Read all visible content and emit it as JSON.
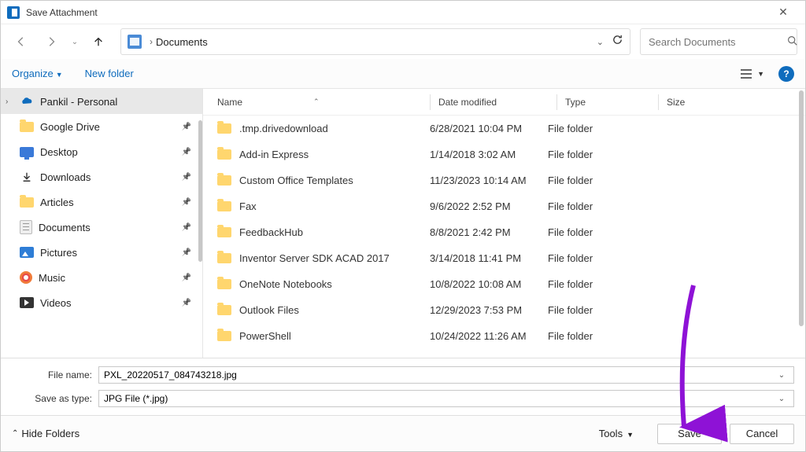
{
  "window": {
    "title": "Save Attachment"
  },
  "breadcrumb": {
    "location": "Documents"
  },
  "search": {
    "placeholder": "Search Documents"
  },
  "toolbar": {
    "organize": "Organize",
    "new_folder": "New folder"
  },
  "tree": {
    "root": "Pankil - Personal",
    "items": [
      {
        "label": "Google Drive",
        "icon": "folder"
      },
      {
        "label": "Desktop",
        "icon": "desktop"
      },
      {
        "label": "Downloads",
        "icon": "download"
      },
      {
        "label": "Articles",
        "icon": "folder"
      },
      {
        "label": "Documents",
        "icon": "doc"
      },
      {
        "label": "Pictures",
        "icon": "pic"
      },
      {
        "label": "Music",
        "icon": "music"
      },
      {
        "label": "Videos",
        "icon": "video"
      }
    ]
  },
  "columns": {
    "name": "Name",
    "date": "Date modified",
    "type": "Type",
    "size": "Size"
  },
  "rows": [
    {
      "name": ".tmp.drivedownload",
      "date": "6/28/2021 10:04 PM",
      "type": "File folder"
    },
    {
      "name": "Add-in Express",
      "date": "1/14/2018 3:02 AM",
      "type": "File folder"
    },
    {
      "name": "Custom Office Templates",
      "date": "11/23/2023 10:14 AM",
      "type": "File folder"
    },
    {
      "name": "Fax",
      "date": "9/6/2022 2:52 PM",
      "type": "File folder"
    },
    {
      "name": "FeedbackHub",
      "date": "8/8/2021 2:42 PM",
      "type": "File folder"
    },
    {
      "name": "Inventor Server SDK ACAD 2017",
      "date": "3/14/2018 11:41 PM",
      "type": "File folder"
    },
    {
      "name": "OneNote Notebooks",
      "date": "10/8/2022 10:08 AM",
      "type": "File folder"
    },
    {
      "name": "Outlook Files",
      "date": "12/29/2023 7:53 PM",
      "type": "File folder"
    },
    {
      "name": "PowerShell",
      "date": "10/24/2022 11:26 AM",
      "type": "File folder"
    }
  ],
  "fields": {
    "filename_label": "File name:",
    "filename_value": "PXL_20220517_084743218.jpg",
    "type_label": "Save as type:",
    "type_value": "JPG File (*.jpg)"
  },
  "footer": {
    "hide": "Hide Folders",
    "tools": "Tools",
    "save": "Save",
    "cancel": "Cancel"
  }
}
